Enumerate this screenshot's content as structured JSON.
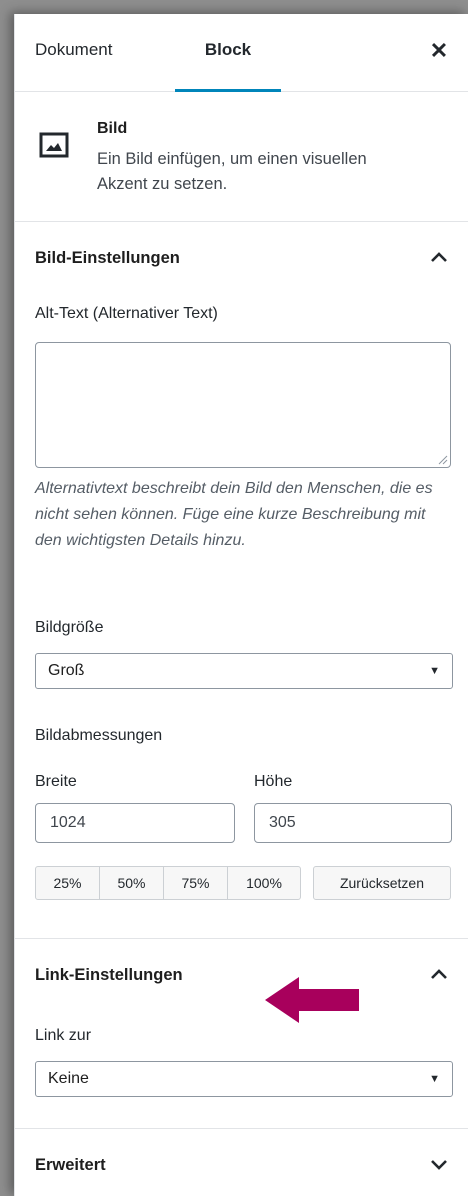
{
  "tabs": {
    "document": "Dokument",
    "block": "Block"
  },
  "close_icon": "close-icon",
  "block_card": {
    "icon": "image-icon",
    "title": "Bild",
    "description": "Ein Bild einfügen, um einen visuellen Akzent zu setzen."
  },
  "image_settings": {
    "title": "Bild-Einstellungen",
    "expanded": true,
    "alt_label": "Alt-Text (Alternativer Text)",
    "alt_value": "",
    "alt_help": "Alternativtext beschreibt dein Bild den Menschen, die es nicht sehen können. Füge eine kurze Beschreibung mit den wichtigsten Details hinzu.",
    "size_label": "Bildgröße",
    "size_value": "Groß",
    "dimensions_label": "Bildabmessungen",
    "width_label": "Breite",
    "width_value": "1024",
    "height_label": "Höhe",
    "height_value": "305",
    "scale_buttons": [
      "25%",
      "50%",
      "75%",
      "100%"
    ],
    "reset_label": "Zurücksetzen"
  },
  "link_settings": {
    "title": "Link-Einstellungen",
    "expanded": true,
    "link_label": "Link zur",
    "link_value": "Keine",
    "annotation_arrow_color": "#a8005c"
  },
  "advanced": {
    "title": "Erweitert",
    "expanded": false
  },
  "colors": {
    "tab_active": "#0085ba",
    "text": "#23282d",
    "help_text": "#555d66"
  }
}
